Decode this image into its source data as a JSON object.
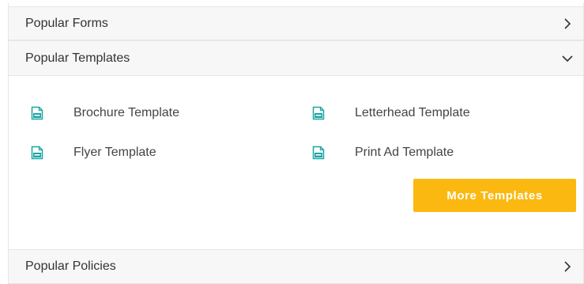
{
  "sections": [
    {
      "title": "Popular Forms",
      "state": "collapsed",
      "icon": "chevron-right-icon"
    },
    {
      "title": "Popular Templates",
      "state": "expanded",
      "icon": "chevron-down-icon"
    },
    {
      "title": "Popular Policies",
      "state": "collapsed",
      "icon": "chevron-right-icon"
    }
  ],
  "templates": {
    "items": [
      {
        "label": "Brochure Template",
        "icon": "pdf-file-icon"
      },
      {
        "label": "Letterhead Template",
        "icon": "pdf-file-icon"
      },
      {
        "label": "Flyer Template",
        "icon": "pdf-file-icon"
      },
      {
        "label": "Print Ad Template",
        "icon": "pdf-file-icon"
      }
    ],
    "more_button_label": "More Templates"
  },
  "colors": {
    "accent_button": "#fbb810",
    "pdf_icon": "#1aa6a6",
    "header_background": "#f7f7f7"
  }
}
